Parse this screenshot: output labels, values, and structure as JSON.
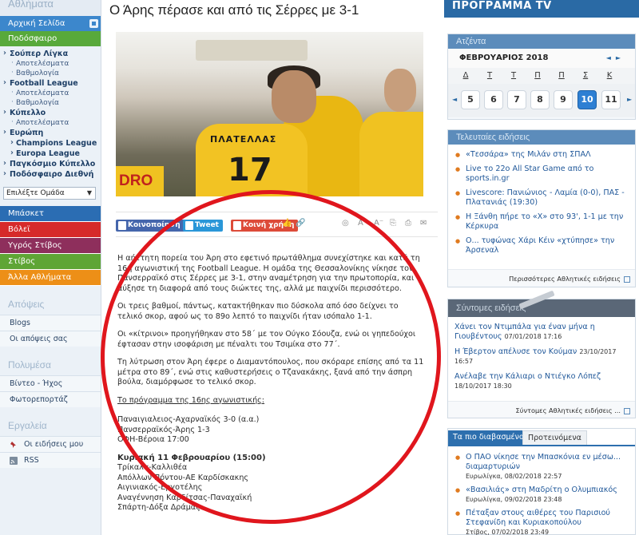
{
  "sidebar": {
    "top_label": "Αθλήματα",
    "home": "Αρχική Σελίδα",
    "football": "Ποδόσφαιρο",
    "groups": [
      {
        "label": "Σούπερ Λίγκα",
        "subs": [
          "Αποτελέσματα",
          "Βαθμολογία"
        ]
      },
      {
        "label": "Football League",
        "subs": [
          "Αποτελέσματα",
          "Βαθμολογία"
        ]
      },
      {
        "label": "Κύπελλο",
        "subs": [
          "Αποτελέσματα"
        ]
      }
    ],
    "europe": "Ευρώπη",
    "europe_subs": [
      "Champions League",
      "Europa League"
    ],
    "world_cup": "Παγκόσμιο Κύπελλο",
    "world_football": "Ποδόσφαιρο Διεθνή",
    "team_select": "Επιλέξτε Ομάδα",
    "sports": [
      {
        "label": "Μπάσκετ",
        "color": "#2b6db3"
      },
      {
        "label": "Βόλεϊ",
        "color": "#d62a2a"
      },
      {
        "label": "Υγρός Στίβος",
        "color": "#8e2f5c"
      },
      {
        "label": "Στίβος",
        "color": "#5fa535"
      },
      {
        "label": "Άλλα Αθλήματα",
        "color": "#ed8f17"
      }
    ],
    "opinions_title": "Απόψεις",
    "opinions": [
      "Blogs",
      "Οι απόψεις σας"
    ],
    "media_title": "Πολυμέσα",
    "media": [
      "Βίντεο - Ήχος",
      "Φωτορεπορτάζ"
    ],
    "tools_title": "Εργαλεία",
    "tools": [
      "Οι ειδήσεις μου",
      "RSS"
    ]
  },
  "article": {
    "title": "Ο Άρης πέρασε και από τις Σέρρες με 3-1",
    "photo": {
      "name_text": "ΠΛΑΤΕΛΛΑΣ",
      "number_text": "17",
      "sponsor_text": "DRO"
    },
    "share": {
      "facebook": "Κοινοποίηση 0",
      "tweet": "Tweet",
      "google": "Κοινή χρήση"
    },
    "paragraphs": [
      "Η αήττητη πορεία του Άρη στο εφετινό πρωτάθλημα συνεχίστηκε και κατά τη 16η αγωνιστική της Football League. Η ομάδα της Θεσσαλονίκης νίκησε τον Πανσερραϊκό στις Σέρρες με 3-1, στην αναμέτρηση για την πρωτοπορία, και αύξησε τη διαφορά από τους διώκτες της, αλλά με παιχνίδι περισσότερο.",
      "Οι τρεις βαθμοί, πάντως, κατακτήθηκαν πιο δύσκολα από όσο δείχνει το τελικό σκορ, αφού ως το 89ο λεπτό το παιχνίδι ήταν ισόπαλο 1-1.",
      "Οι «κίτρινοι» προηγήθηκαν στο 58΄ με τον Ούγκο Σόουζα, ενώ οι γηπεδούχοι έφτασαν στην ισοφάριση με πέναλτι του Τσιμίκα στο 77΄.",
      "Τη λύτρωση στον Άρη έφερε ο Διαμαντόπουλος, που σκόραρε επίσης από τα 11 μέτρα στο 89΄, ενώ στις καθυστερήσεις ο Τζανακάκης, ξανά από την άσπρη βούλα, διαμόρφωσε το τελικό σκορ."
    ],
    "schedule_title": "Το πρόγραμμα της 16ης αγωνιστικής:",
    "schedule_1": [
      "Παναιγιαλειος-Αχαρναϊκός 3-0 (α.α.)",
      "Πανσερραϊκός-Άρης 1-3",
      "ΟΦΗ-Βέροια 17:00"
    ],
    "sunday_title": "Κυριακή 11 Φεβρουαρίου (15:00)",
    "schedule_2": [
      "Τρίκαλα-Καλλιθέα",
      "Απόλλων Πόντου-ΑΕ Καρδίσκακης",
      "Αιγινιακός-Εργοτέλης",
      "Αναγέννηση Καρδίτσας-Παναχαϊκή",
      "Σπάρτη-Δόξα Δράμας"
    ]
  },
  "right": {
    "tv_banner": "ΠΡΟΓΡΑΜΜΑ TV",
    "agenda": {
      "title": "Ατζέντα",
      "month": "ΦΕΒΡΟΥΑΡΙΟΣ 2018",
      "days": [
        "Δ",
        "Τ",
        "Τ",
        "Π",
        "Π",
        "Σ",
        "Κ"
      ],
      "dates": [
        "5",
        "6",
        "7",
        "8",
        "9",
        "10",
        "11"
      ],
      "selected_date": "10"
    },
    "latest": {
      "title": "Τελευταίες ειδήσεις",
      "items": [
        "«Τεσσάρα» της Μιλάν στη ΣΠΑΛ",
        "Live το 22ο All Star Game από το sports.in.gr",
        "Livescore: Πανιώνιος - Λαμία (0-0), ΠΑΣ - Πλατανιάς (19:30)",
        "Η Ξάνθη πήρε το «Χ» στο 93', 1-1 με την Κέρκυρα",
        "Ο... τυφώνας Χάρι Κέιν «χτύπησε» την Άρσεναλ"
      ],
      "more": "Περισσότερες Αθλητικές ειδήσεις"
    },
    "short": {
      "title": "Σύντομες ειδήσεις",
      "items": [
        {
          "text": "Χάνει τον Ντιμπάλα για έναν μήνα η Γιουβέντους",
          "meta": "07/01/2018  17:16"
        },
        {
          "text": "Η Έβερτον απέλυσε τον Κούμαν",
          "meta": "23/10/2017  16:57"
        },
        {
          "text": "Ανέλαβε την Κάλιαρι ο Ντιέγκο Λόπεζ",
          "meta": "18/10/2017  18:30"
        }
      ],
      "more": "Σύντομες Αθλητικές ειδήσεις ..."
    },
    "popular": {
      "tab_active": "Τα πιο διαβασμένα",
      "tab_inactive": "Προτεινόμενα",
      "items": [
        {
          "text": "Ο ΠΑΟ νίκησε την Μπασκόνια εν μέσω... διαμαρτυριών",
          "meta": "Ευρωλίγκα, 08/02/2018 22:57"
        },
        {
          "text": "«Βασιλιάς» στη Μαδρίτη ο Ολυμπιακός",
          "meta": "Ευρωλίγκα, 09/02/2018 23:48"
        },
        {
          "text": "Πέταξαν στους αιθέρες του Παρισιού Στεφανίδη και Κυριακοπούλου",
          "meta": "Στίβος, 07/02/2018 23:49"
        }
      ]
    }
  }
}
